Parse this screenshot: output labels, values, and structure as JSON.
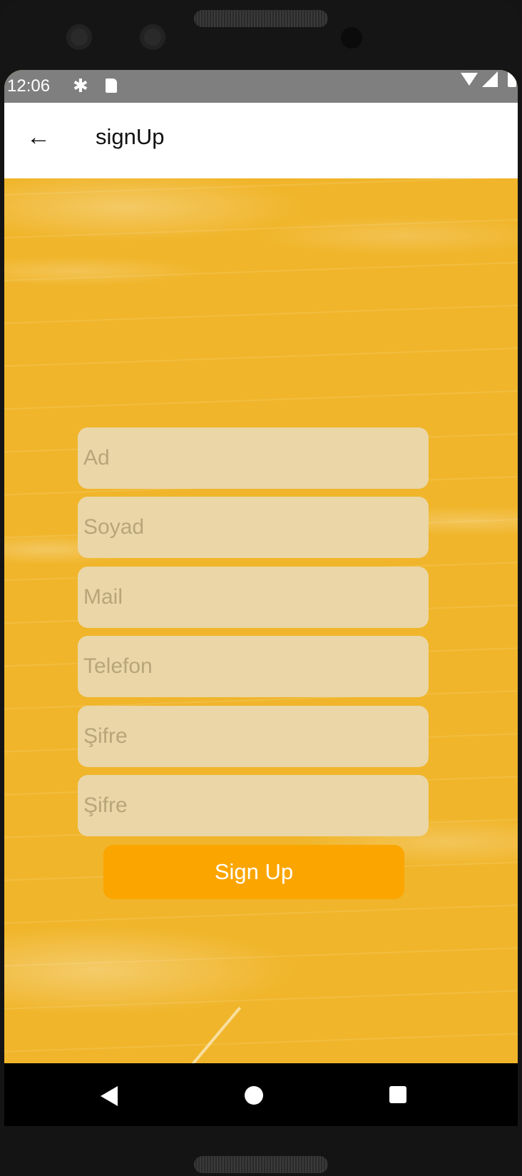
{
  "status_bar": {
    "time": "12:06",
    "icons": [
      "gear-icon",
      "sd-card-icon",
      "wifi-icon",
      "signal-icon",
      "battery-icon"
    ]
  },
  "app_bar": {
    "back_icon": "arrow-left-icon",
    "title": "signUp"
  },
  "form": {
    "fields": [
      {
        "placeholder": "Ad",
        "value": ""
      },
      {
        "placeholder": "Soyad",
        "value": ""
      },
      {
        "placeholder": "Mail",
        "value": ""
      },
      {
        "placeholder": "Telefon",
        "value": ""
      },
      {
        "placeholder": "Şifre",
        "value": ""
      },
      {
        "placeholder": "Şifre",
        "value": ""
      }
    ],
    "submit_label": "Sign Up"
  },
  "nav_bar": {
    "icons": [
      "nav-back-icon",
      "nav-home-icon",
      "nav-recents-icon"
    ]
  },
  "colors": {
    "background": "#f0b52a",
    "field": "#ead6a6",
    "button": "#fba500",
    "status_bar": "#7f7f7f"
  }
}
